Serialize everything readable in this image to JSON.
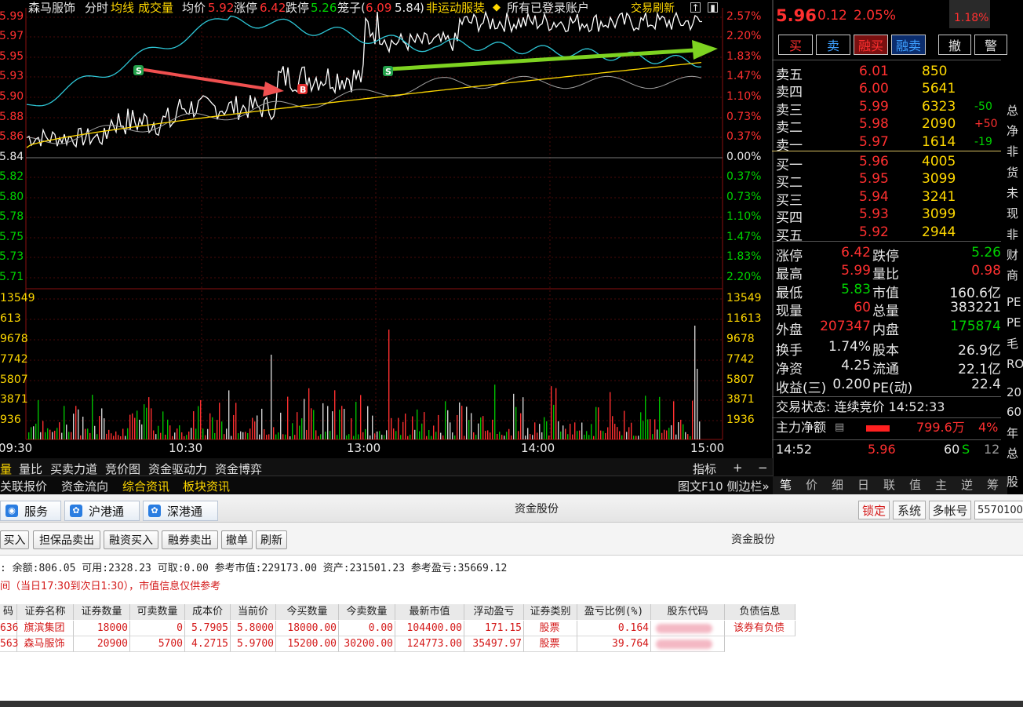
{
  "header": {
    "stock_name": "森马服饰",
    "tab_fenshi": "分时",
    "tab_junxian": "均线",
    "tab_volume": "成交量",
    "avg_label": "均价",
    "avg_value": "5.92",
    "limit_up_label": "涨停",
    "limit_up_value": "6.42",
    "limit_down_label": "跌停",
    "limit_down_value": "5.26",
    "cage_label": "笼子(",
    "cage_value1": "6.09",
    "cage_value2": "5.84",
    ")": ")",
    "cage_close": ")",
    "category": "非运动服装",
    "accounts": "所有已登录账户",
    "refresh": "交易刷新"
  },
  "price_axis_left": [
    "5.99",
    "5.97",
    "5.95",
    "5.93",
    "5.90",
    "5.88",
    "5.86",
    "5.84",
    "5.82",
    "5.80",
    "5.78",
    "5.75",
    "5.73",
    "5.71"
  ],
  "pct_axis_right": [
    "2.57%",
    "2.20%",
    "1.83%",
    "1.47%",
    "1.10%",
    "0.73%",
    "0.37%",
    "0.00%",
    "0.37%",
    "0.73%",
    "1.10%",
    "1.47%",
    "1.83%",
    "2.20%"
  ],
  "vol_axis": [
    "13549",
    "11613",
    "9678",
    "7742",
    "5807",
    "3871",
    "1936"
  ],
  "vol_axis_left": [
    "13549",
    "613",
    "9678",
    "7742",
    "5807",
    "3871",
    "936"
  ],
  "time_axis": [
    "09:30",
    "10:30",
    "13:00",
    "14:00",
    "15:00"
  ],
  "markers": {
    "s1": "S",
    "b1": "B",
    "s2": "S"
  },
  "quote": {
    "price": "5.96",
    "change": "0.12",
    "pct": "2.05%",
    "badge": "1.18%"
  },
  "action_buttons": [
    "买",
    "卖",
    "融买",
    "融卖",
    "撤",
    "警"
  ],
  "asks": [
    {
      "label": "卖五",
      "price": "6.01",
      "vol": "850",
      "chg": ""
    },
    {
      "label": "卖四",
      "price": "6.00",
      "vol": "5641",
      "chg": ""
    },
    {
      "label": "卖三",
      "price": "5.99",
      "vol": "6323",
      "chg": "-50"
    },
    {
      "label": "卖二",
      "price": "5.98",
      "vol": "2090",
      "chg": "+50"
    },
    {
      "label": "卖一",
      "price": "5.97",
      "vol": "1614",
      "chg": "-19"
    }
  ],
  "bids": [
    {
      "label": "买一",
      "price": "5.96",
      "vol": "4005"
    },
    {
      "label": "买二",
      "price": "5.95",
      "vol": "3099"
    },
    {
      "label": "买三",
      "price": "5.94",
      "vol": "3241"
    },
    {
      "label": "买四",
      "price": "5.93",
      "vol": "3099"
    },
    {
      "label": "买五",
      "price": "5.92",
      "vol": "2944"
    }
  ],
  "stats": [
    {
      "l1": "涨停",
      "v1": "6.42",
      "l2": "跌停",
      "v2": "5.26"
    },
    {
      "l1": "最高",
      "v1": "5.99",
      "l2": "量比",
      "v2": "0.98"
    },
    {
      "l1": "最低",
      "v1": "5.83",
      "l2": "市值",
      "v2": "160.6亿"
    },
    {
      "l1": "现量",
      "v1": "60",
      "l2": "总量",
      "v2": "383221"
    },
    {
      "l1": "外盘",
      "v1": "207347",
      "l2": "内盘",
      "v2": "175874"
    },
    {
      "l1": "换手",
      "v1": "1.74%",
      "l2": "股本",
      "v2": "26.9亿"
    },
    {
      "l1": "净资",
      "v1": "4.25",
      "l2": "流通",
      "v2": "22.1亿"
    },
    {
      "l1": "收益(三)",
      "v1": "0.200",
      "l2": "PE(动)",
      "v2": "22.4"
    }
  ],
  "status": {
    "label": "交易状态: 连续竞价 14:52:33",
    "main_net_label": "主力净额",
    "main_net_value": "799.6万",
    "main_net_pct": "4%"
  },
  "tick": {
    "time": "14:52",
    "price": "5.96",
    "vol": "60",
    "side": "S",
    "extra": "12"
  },
  "far_right": [
    "总",
    "净",
    "非",
    "货",
    "未",
    "现",
    "非",
    "财",
    "商",
    "PE",
    "PE",
    "毛",
    "RO",
    "20",
    "60",
    "年",
    "总",
    "股"
  ],
  "panel_tabs": [
    "笔",
    "价",
    "细",
    "日",
    "联",
    "值",
    "主",
    "逆",
    "筹"
  ],
  "bottom_tabs1": [
    "量",
    "量比",
    "买卖力道",
    "竞价图",
    "资金驱动力",
    "资金博弈"
  ],
  "bottom_tabs1_right": [
    "指标",
    "+",
    "−"
  ],
  "bottom_tabs2": [
    "关联报价",
    "资金流向",
    "综合资讯",
    "板块资讯"
  ],
  "bottom_tabs2_right": "图文F10 侧边栏»",
  "trade": {
    "top_tabs": [
      "服务",
      "沪港通",
      "深港通"
    ],
    "title": "资金股份",
    "lock": "锁定",
    "system": "系统",
    "multi": "多帐号",
    "account": "55701000",
    "buttons": [
      "买入",
      "担保品卖出",
      "融资买入",
      "融券卖出",
      "撤单",
      "刷新"
    ],
    "subtitle": "资金股份",
    "summary": ":  余额:806.05   可用:2328.23   可取:0.00   参考市值:229173.00   资产:231501.23   参考盈亏:35669.12",
    "notice": "间（当日17:30到次日1:30），市值信息仅供参考",
    "columns": [
      "码",
      "证券名称",
      "证券数量",
      "可卖数量",
      "成本价",
      "当前价",
      "今买数量",
      "今卖数量",
      "最新市值",
      "浮动盈亏",
      "证券类别",
      "盈亏比例(%)",
      "股东代码",
      "负债信息"
    ],
    "rows": [
      [
        "636",
        "旗滨集团",
        "18000",
        "0",
        "5.7905",
        "5.8000",
        "18000.00",
        "0.00",
        "104400.00",
        "171.15",
        "股票",
        "0.164",
        "",
        "该券有负债"
      ],
      [
        "563",
        "森马服饰",
        "20900",
        "5700",
        "4.2715",
        "5.9700",
        "15200.00",
        "30200.00",
        "124773.00",
        "35497.97",
        "股票",
        "39.764",
        "",
        ""
      ]
    ]
  },
  "colors": {
    "up": "#ff3030",
    "down": "#00d400",
    "price_line": "#ffffff",
    "avg_line": "#ffd800",
    "cyan_line": "#2ec6d6",
    "gray_line": "#a0a0a0",
    "arrow_red": "#f05050",
    "arrow_green": "#7ed321"
  }
}
